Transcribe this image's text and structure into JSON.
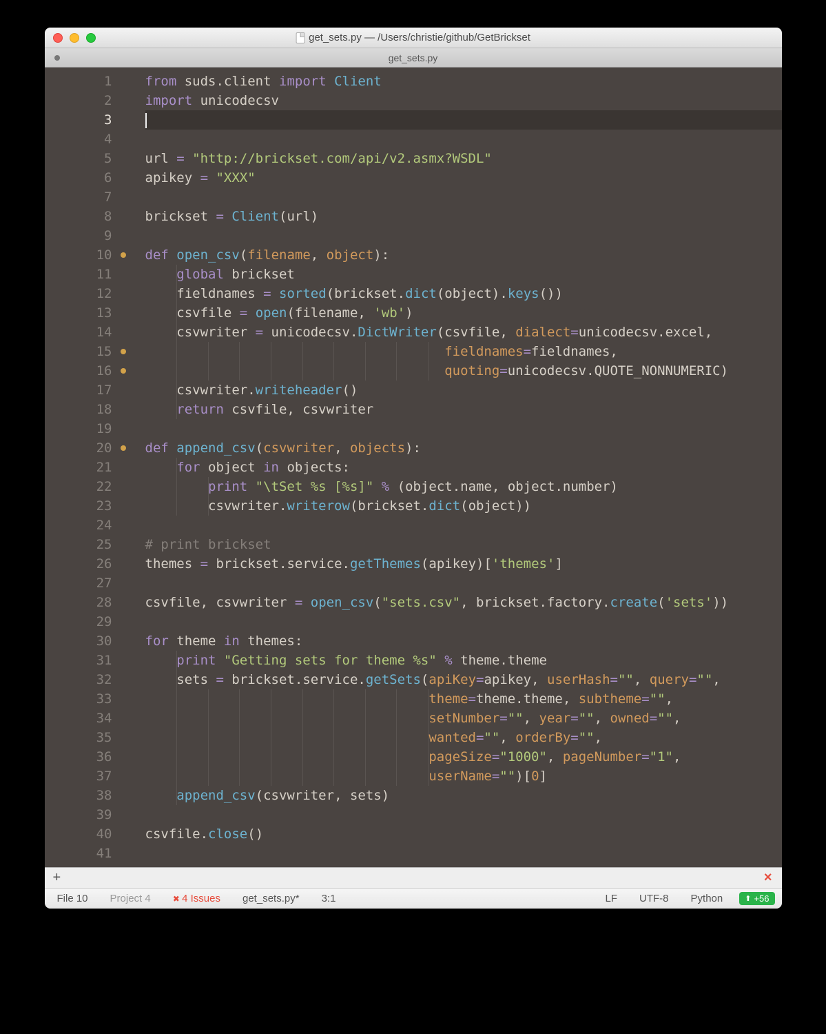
{
  "window": {
    "title": "get_sets.py — /Users/christie/github/GetBrickset",
    "tab": "get_sets.py"
  },
  "status": {
    "file": "File  10",
    "project": "Project  4",
    "issues": "4 Issues",
    "filename": "get_sets.py*",
    "pos": "3:1",
    "eol": "LF",
    "encoding": "UTF-8",
    "lang": "Python",
    "add": "+56"
  },
  "lines_total": 41,
  "current_line": 3,
  "dot_lines": [
    10,
    15,
    16,
    20
  ],
  "code": [
    [
      [
        "kw",
        "from"
      ],
      [
        "op",
        " suds"
      ],
      [
        "op",
        "."
      ],
      [
        "op",
        "client "
      ],
      [
        "kw",
        "import"
      ],
      [
        "op",
        " "
      ],
      [
        "fn",
        "Client"
      ]
    ],
    [
      [
        "kw",
        "import"
      ],
      [
        "op",
        " unicodecsv"
      ]
    ],
    [],
    [],
    [
      [
        "op",
        "url "
      ],
      [
        "kw",
        "="
      ],
      [
        "op",
        " "
      ],
      [
        "str",
        "\"http://brickset.com/api/v2.asmx?WSDL\""
      ]
    ],
    [
      [
        "op",
        "apikey "
      ],
      [
        "kw",
        "="
      ],
      [
        "op",
        " "
      ],
      [
        "str",
        "\"XXX\""
      ]
    ],
    [],
    [
      [
        "op",
        "brickset "
      ],
      [
        "kw",
        "="
      ],
      [
        "op",
        " "
      ],
      [
        "fn",
        "Client"
      ],
      [
        "op",
        "("
      ],
      [
        "op",
        "url"
      ],
      [
        "op",
        ")"
      ]
    ],
    [],
    [
      [
        "kw",
        "def"
      ],
      [
        "op",
        " "
      ],
      [
        "fn",
        "open_csv"
      ],
      [
        "op",
        "("
      ],
      [
        "num",
        "filename"
      ],
      [
        "op",
        ", "
      ],
      [
        "num",
        "object"
      ],
      [
        "op",
        "):"
      ]
    ],
    [
      [
        "op",
        "    "
      ],
      [
        "kw",
        "global"
      ],
      [
        "op",
        " brickset"
      ]
    ],
    [
      [
        "op",
        "    fieldnames "
      ],
      [
        "kw",
        "="
      ],
      [
        "op",
        " "
      ],
      [
        "fn",
        "sorted"
      ],
      [
        "op",
        "("
      ],
      [
        "op",
        "brickset"
      ],
      [
        "op",
        "."
      ],
      [
        "fn",
        "dict"
      ],
      [
        "op",
        "("
      ],
      [
        "op",
        "object"
      ],
      [
        "op",
        ")"
      ],
      [
        "op",
        "."
      ],
      [
        "fn",
        "keys"
      ],
      [
        "op",
        "("
      ],
      [
        "op",
        ")"
      ],
      [
        "op",
        ")"
      ]
    ],
    [
      [
        "op",
        "    csvfile "
      ],
      [
        "kw",
        "="
      ],
      [
        "op",
        " "
      ],
      [
        "fn",
        "open"
      ],
      [
        "op",
        "("
      ],
      [
        "op",
        "filename"
      ],
      [
        "op",
        ", "
      ],
      [
        "str",
        "'wb'"
      ],
      [
        "op",
        ")"
      ]
    ],
    [
      [
        "op",
        "    csvwriter "
      ],
      [
        "kw",
        "="
      ],
      [
        "op",
        " unicodecsv"
      ],
      [
        "op",
        "."
      ],
      [
        "fn",
        "DictWriter"
      ],
      [
        "op",
        "("
      ],
      [
        "op",
        "csvfile"
      ],
      [
        "op",
        ", "
      ],
      [
        "num",
        "dialect"
      ],
      [
        "kw",
        "="
      ],
      [
        "op",
        "unicodecsv"
      ],
      [
        "op",
        "."
      ],
      [
        "op",
        "excel"
      ],
      [
        "op",
        ","
      ]
    ],
    [
      [
        "op",
        "                                      "
      ],
      [
        "num",
        "fieldnames"
      ],
      [
        "kw",
        "="
      ],
      [
        "op",
        "fieldnames"
      ],
      [
        "op",
        ","
      ]
    ],
    [
      [
        "op",
        "                                      "
      ],
      [
        "num",
        "quoting"
      ],
      [
        "kw",
        "="
      ],
      [
        "op",
        "unicodecsv"
      ],
      [
        "op",
        "."
      ],
      [
        "op",
        "QUOTE_NONNUMERIC"
      ],
      [
        "op",
        ")"
      ]
    ],
    [
      [
        "op",
        "    csvwriter"
      ],
      [
        "op",
        "."
      ],
      [
        "fn",
        "writeheader"
      ],
      [
        "op",
        "("
      ],
      [
        "op",
        ")"
      ]
    ],
    [
      [
        "op",
        "    "
      ],
      [
        "kw",
        "return"
      ],
      [
        "op",
        " csvfile"
      ],
      [
        "op",
        ", csvwriter"
      ]
    ],
    [],
    [
      [
        "kw",
        "def"
      ],
      [
        "op",
        " "
      ],
      [
        "fn",
        "append_csv"
      ],
      [
        "op",
        "("
      ],
      [
        "num",
        "csvwriter"
      ],
      [
        "op",
        ", "
      ],
      [
        "num",
        "objects"
      ],
      [
        "op",
        "):"
      ]
    ],
    [
      [
        "op",
        "    "
      ],
      [
        "kw",
        "for"
      ],
      [
        "op",
        " object "
      ],
      [
        "kw",
        "in"
      ],
      [
        "op",
        " objects:"
      ]
    ],
    [
      [
        "op",
        "        "
      ],
      [
        "kw",
        "print"
      ],
      [
        "op",
        " "
      ],
      [
        "str",
        "\"\\tSet %s [%s]\""
      ],
      [
        "op",
        " "
      ],
      [
        "kw",
        "%"
      ],
      [
        "op",
        " ("
      ],
      [
        "op",
        "object"
      ],
      [
        "op",
        "."
      ],
      [
        "op",
        "name"
      ],
      [
        "op",
        ", "
      ],
      [
        "op",
        "object"
      ],
      [
        "op",
        "."
      ],
      [
        "op",
        "number"
      ],
      [
        "op",
        ")"
      ]
    ],
    [
      [
        "op",
        "        csvwriter"
      ],
      [
        "op",
        "."
      ],
      [
        "fn",
        "writerow"
      ],
      [
        "op",
        "("
      ],
      [
        "op",
        "brickset"
      ],
      [
        "op",
        "."
      ],
      [
        "fn",
        "dict"
      ],
      [
        "op",
        "("
      ],
      [
        "op",
        "object"
      ],
      [
        "op",
        ")"
      ],
      [
        "op",
        ")"
      ]
    ],
    [],
    [
      [
        "cmt",
        "# print brickset"
      ]
    ],
    [
      [
        "op",
        "themes "
      ],
      [
        "kw",
        "="
      ],
      [
        "op",
        " brickset"
      ],
      [
        "op",
        "."
      ],
      [
        "op",
        "service"
      ],
      [
        "op",
        "."
      ],
      [
        "fn",
        "getThemes"
      ],
      [
        "op",
        "("
      ],
      [
        "op",
        "apikey"
      ],
      [
        "op",
        ")"
      ],
      [
        "op",
        "["
      ],
      [
        "str",
        "'themes'"
      ],
      [
        "op",
        "]"
      ]
    ],
    [],
    [
      [
        "op",
        "csvfile"
      ],
      [
        "op",
        ", csvwriter "
      ],
      [
        "kw",
        "="
      ],
      [
        "op",
        " "
      ],
      [
        "fn",
        "open_csv"
      ],
      [
        "op",
        "("
      ],
      [
        "str",
        "\"sets.csv\""
      ],
      [
        "op",
        ", brickset"
      ],
      [
        "op",
        "."
      ],
      [
        "op",
        "factory"
      ],
      [
        "op",
        "."
      ],
      [
        "fn",
        "create"
      ],
      [
        "op",
        "("
      ],
      [
        "str",
        "'sets'"
      ],
      [
        "op",
        ")"
      ],
      [
        "op",
        ")"
      ]
    ],
    [],
    [
      [
        "kw",
        "for"
      ],
      [
        "op",
        " theme "
      ],
      [
        "kw",
        "in"
      ],
      [
        "op",
        " themes:"
      ]
    ],
    [
      [
        "op",
        "    "
      ],
      [
        "kw",
        "print"
      ],
      [
        "op",
        " "
      ],
      [
        "str",
        "\"Getting sets for theme %s\""
      ],
      [
        "op",
        " "
      ],
      [
        "kw",
        "%"
      ],
      [
        "op",
        " theme"
      ],
      [
        "op",
        "."
      ],
      [
        "op",
        "theme"
      ]
    ],
    [
      [
        "op",
        "    sets "
      ],
      [
        "kw",
        "="
      ],
      [
        "op",
        " brickset"
      ],
      [
        "op",
        "."
      ],
      [
        "op",
        "service"
      ],
      [
        "op",
        "."
      ],
      [
        "fn",
        "getSets"
      ],
      [
        "op",
        "("
      ],
      [
        "num",
        "apiKey"
      ],
      [
        "kw",
        "="
      ],
      [
        "op",
        "apikey"
      ],
      [
        "op",
        ", "
      ],
      [
        "num",
        "userHash"
      ],
      [
        "kw",
        "="
      ],
      [
        "str",
        "\"\""
      ],
      [
        "op",
        ", "
      ],
      [
        "num",
        "query"
      ],
      [
        "kw",
        "="
      ],
      [
        "str",
        "\"\""
      ],
      [
        "op",
        ","
      ]
    ],
    [
      [
        "op",
        "                                    "
      ],
      [
        "num",
        "theme"
      ],
      [
        "kw",
        "="
      ],
      [
        "op",
        "theme"
      ],
      [
        "op",
        "."
      ],
      [
        "op",
        "theme"
      ],
      [
        "op",
        ", "
      ],
      [
        "num",
        "subtheme"
      ],
      [
        "kw",
        "="
      ],
      [
        "str",
        "\"\""
      ],
      [
        "op",
        ","
      ]
    ],
    [
      [
        "op",
        "                                    "
      ],
      [
        "num",
        "setNumber"
      ],
      [
        "kw",
        "="
      ],
      [
        "str",
        "\"\""
      ],
      [
        "op",
        ", "
      ],
      [
        "num",
        "year"
      ],
      [
        "kw",
        "="
      ],
      [
        "str",
        "\"\""
      ],
      [
        "op",
        ", "
      ],
      [
        "num",
        "owned"
      ],
      [
        "kw",
        "="
      ],
      [
        "str",
        "\"\""
      ],
      [
        "op",
        ","
      ]
    ],
    [
      [
        "op",
        "                                    "
      ],
      [
        "num",
        "wanted"
      ],
      [
        "kw",
        "="
      ],
      [
        "str",
        "\"\""
      ],
      [
        "op",
        ", "
      ],
      [
        "num",
        "orderBy"
      ],
      [
        "kw",
        "="
      ],
      [
        "str",
        "\"\""
      ],
      [
        "op",
        ","
      ]
    ],
    [
      [
        "op",
        "                                    "
      ],
      [
        "num",
        "pageSize"
      ],
      [
        "kw",
        "="
      ],
      [
        "str",
        "\"1000\""
      ],
      [
        "op",
        ", "
      ],
      [
        "num",
        "pageNumber"
      ],
      [
        "kw",
        "="
      ],
      [
        "str",
        "\"1\""
      ],
      [
        "op",
        ","
      ]
    ],
    [
      [
        "op",
        "                                    "
      ],
      [
        "num",
        "userName"
      ],
      [
        "kw",
        "="
      ],
      [
        "str",
        "\"\""
      ],
      [
        "op",
        ")"
      ],
      [
        "op",
        "["
      ],
      [
        "num",
        "0"
      ],
      [
        "op",
        "]"
      ]
    ],
    [
      [
        "op",
        "    "
      ],
      [
        "fn",
        "append_csv"
      ],
      [
        "op",
        "("
      ],
      [
        "op",
        "csvwriter"
      ],
      [
        "op",
        ", sets"
      ],
      [
        "op",
        ")"
      ]
    ],
    [],
    [
      [
        "op",
        "csvfile"
      ],
      [
        "op",
        "."
      ],
      [
        "fn",
        "close"
      ],
      [
        "op",
        "("
      ],
      [
        "op",
        ")"
      ]
    ],
    []
  ]
}
